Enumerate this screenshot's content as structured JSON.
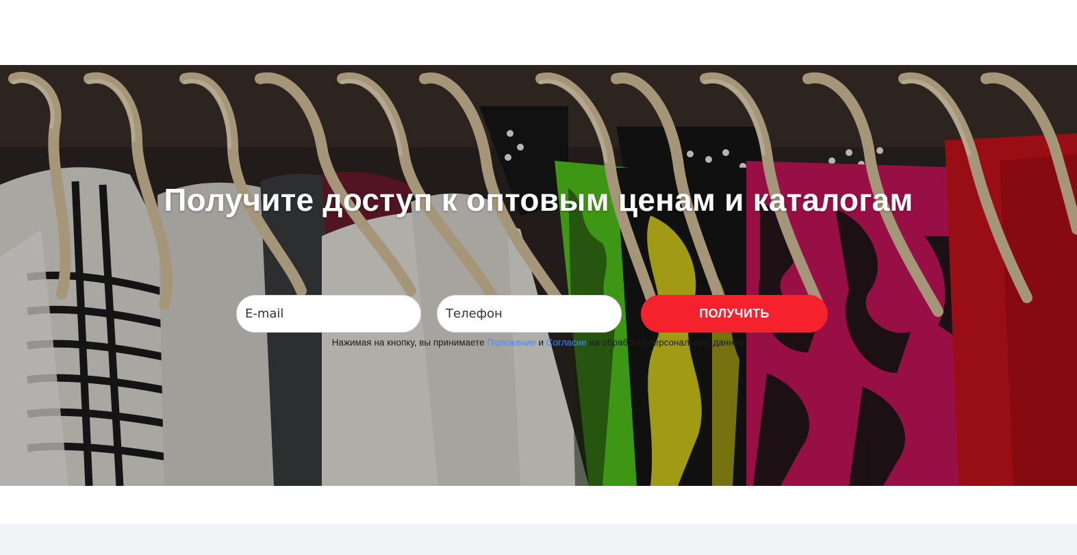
{
  "hero": {
    "title": "Получите доступ к оптовым ценам и каталогам"
  },
  "form": {
    "email_placeholder": "E-mail",
    "phone_placeholder": "Телефон",
    "submit_label": "ПОЛУЧИТЬ"
  },
  "consent": {
    "prefix": "Нажимая на кнопку, вы принимаете",
    "link_regulation": "Положение",
    "conjunction": "и",
    "link_agreement": "Согласие",
    "suffix": "на обработку персональных данных"
  },
  "colors": {
    "accent": "#f5222d",
    "link": "#3b8cff",
    "footer_band": "#f3f4f8"
  }
}
